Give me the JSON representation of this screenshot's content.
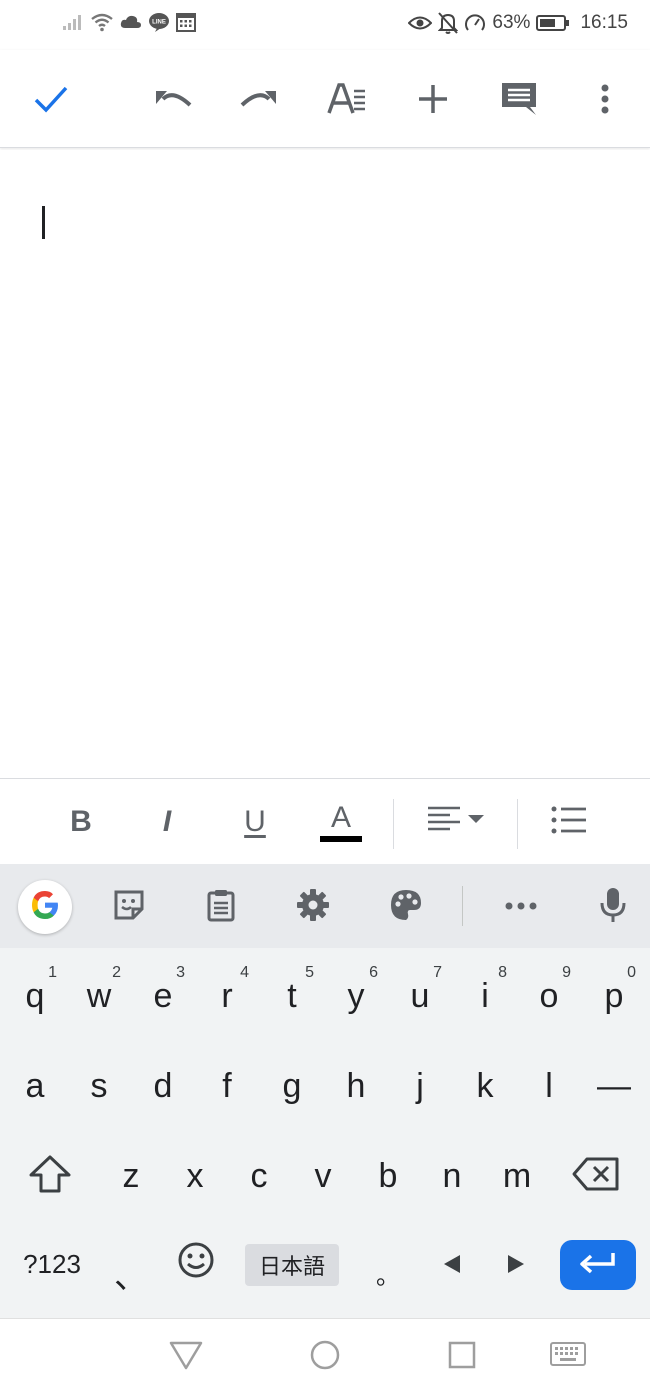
{
  "status_bar": {
    "battery_percent": "63%",
    "time": "16:15",
    "left_icons": [
      "signal-icon",
      "wifi-icon",
      "cloud-icon",
      "line-app-icon",
      "calendar-icon"
    ],
    "right_icons": [
      "eye-icon",
      "bell-off-icon",
      "speed-icon",
      "battery-icon"
    ]
  },
  "toolbar": {
    "buttons": [
      "check-icon",
      "undo-icon",
      "redo-icon",
      "text-format-icon",
      "insert-plus-icon",
      "comment-icon",
      "more-vert-icon"
    ],
    "accent_color": "#1a73e8"
  },
  "document": {
    "content": ""
  },
  "format_bar": {
    "bold": "B",
    "italic": "I",
    "underline": "U",
    "text_color": "A"
  },
  "keyboard": {
    "row1": [
      {
        "ch": "q",
        "hint": "1"
      },
      {
        "ch": "w",
        "hint": "2"
      },
      {
        "ch": "e",
        "hint": "3"
      },
      {
        "ch": "r",
        "hint": "4"
      },
      {
        "ch": "t",
        "hint": "5"
      },
      {
        "ch": "y",
        "hint": "6"
      },
      {
        "ch": "u",
        "hint": "7"
      },
      {
        "ch": "i",
        "hint": "8"
      },
      {
        "ch": "o",
        "hint": "9"
      },
      {
        "ch": "p",
        "hint": "0"
      }
    ],
    "row2": [
      "a",
      "s",
      "d",
      "f",
      "g",
      "h",
      "j",
      "k",
      "l",
      "—"
    ],
    "row3": [
      "z",
      "x",
      "c",
      "v",
      "b",
      "n",
      "m"
    ],
    "symbols_key": "?123",
    "comma_key": "、",
    "language_key": "日本語",
    "period_key": "。"
  },
  "nav_bar": {
    "buttons": [
      "back-icon",
      "home-icon",
      "recents-icon",
      "keyboard-switch-icon"
    ]
  }
}
